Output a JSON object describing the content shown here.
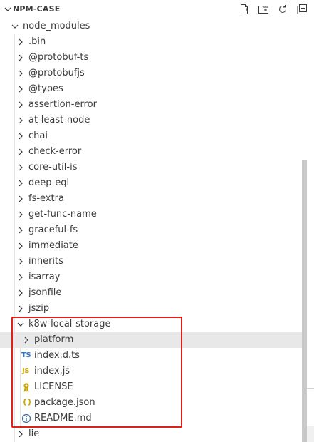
{
  "explorer": {
    "title": "NPM-CASE",
    "actions": [
      "new-file-icon",
      "new-folder-icon",
      "refresh-icon",
      "collapse-all-icon"
    ]
  },
  "tree": {
    "root": "node_modules",
    "folders": [
      ".bin",
      "@protobuf-ts",
      "@protobufjs",
      "@types",
      "assertion-error",
      "at-least-node",
      "chai",
      "check-error",
      "core-util-is",
      "deep-eql",
      "fs-extra",
      "get-func-name",
      "graceful-fs",
      "immediate",
      "inherits",
      "isarray",
      "jsonfile",
      "jszip"
    ],
    "expanded_folder": "k8w-local-storage",
    "children": [
      {
        "name": "platform",
        "type": "folder",
        "icon": "chevron-right-icon"
      },
      {
        "name": "index.d.ts",
        "type": "file",
        "icon": "typescript-icon",
        "glyph": "TS"
      },
      {
        "name": "index.js",
        "type": "file",
        "icon": "javascript-icon",
        "glyph": "JS"
      },
      {
        "name": "LICENSE",
        "type": "file",
        "icon": "license-icon"
      },
      {
        "name": "package.json",
        "type": "file",
        "icon": "json-icon",
        "glyph": "{}"
      },
      {
        "name": "README.md",
        "type": "file",
        "icon": "info-icon"
      }
    ],
    "after": "lie"
  },
  "colors": {
    "highlight": "#e8e8e8",
    "annotation_box": "#e0211b",
    "ts": "#3178c6",
    "js": "#c7a50a"
  }
}
